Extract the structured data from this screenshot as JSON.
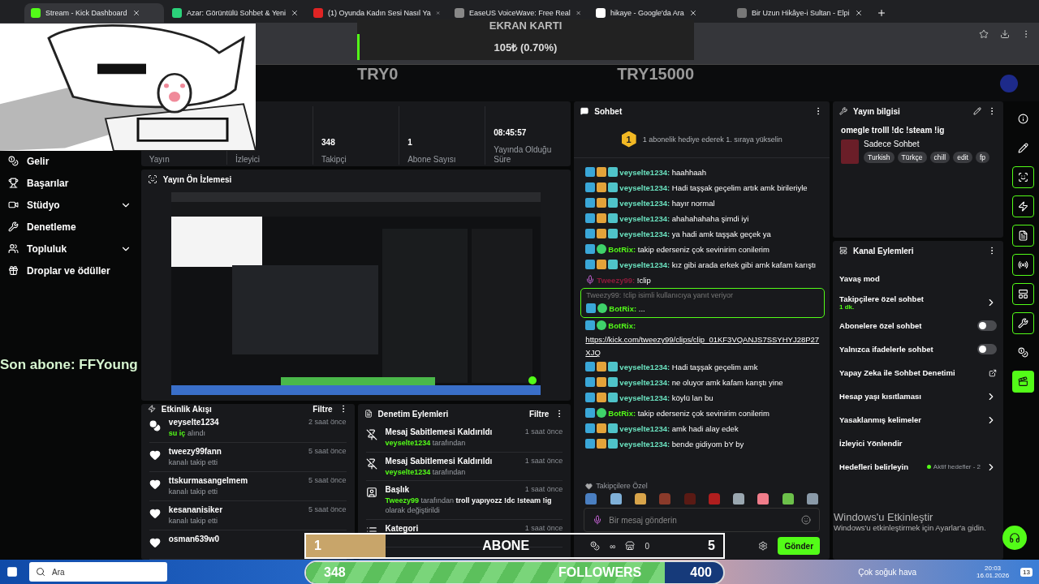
{
  "browser": {
    "tabs": [
      {
        "label": "Stream - Kick Dashboard",
        "selected": true
      },
      {
        "label": "Azar: Görüntülü Sohbet & Yeni",
        "selected": false
      },
      {
        "label": "(1) Oyunda Kadın Sesi Nasıl Ya",
        "selected": false
      },
      {
        "label": "EaseUS VoiceWave: Free Real",
        "selected": false
      },
      {
        "label": "hikaye - Google'da Ara",
        "selected": false
      },
      {
        "label": "Bir Uzun Hikâye-i Sultan - Elpi",
        "selected": false
      }
    ]
  },
  "goal_overlay": {
    "title": "EKRAN KARTI",
    "amount": "105₺ (0.70%)",
    "level": 0.007,
    "min": "TRY0",
    "max": "TRY15000"
  },
  "sidebar": {
    "items": [
      {
        "label": "Gelir",
        "expandable": false
      },
      {
        "label": "Başarılar",
        "expandable": false
      },
      {
        "label": "Stüdyo",
        "expandable": true
      },
      {
        "label": "Denetleme",
        "expandable": false
      },
      {
        "label": "Topluluk",
        "expandable": true
      },
      {
        "label": "Droplar ve ödüller",
        "expandable": false
      }
    ]
  },
  "stats": [
    {
      "label": "Yayın"
    },
    {
      "label": "İzleyici"
    },
    {
      "value": "348",
      "label": "Takipçi"
    },
    {
      "value": "1",
      "label": "Abone Sayısı"
    },
    {
      "value": "08:45:57",
      "label": "Yayında Olduğu Süre"
    }
  ],
  "preview": {
    "title": "Yayın Ön İzlemesi",
    "kind": "picture"
  },
  "last_sub_overlay": "Son abone: FFYoung",
  "activity": {
    "title": "Etkinlik Akışı",
    "filter": "Filtre",
    "items": [
      {
        "kind": "redeem",
        "user": "veyselte1234",
        "highlight": "su iç",
        "detail": "alındı",
        "time": "2 saat önce"
      },
      {
        "kind": "follow",
        "user": "tweezy99fann",
        "detail": "kanalı takip etti",
        "time": "5 saat önce"
      },
      {
        "kind": "follow",
        "user": "ttskurmasangelmem",
        "detail": "kanalı takip etti",
        "time": "5 saat önce"
      },
      {
        "kind": "follow",
        "user": "kesananisiker",
        "detail": "kanalı takip etti",
        "time": "5 saat önce"
      },
      {
        "kind": "follow",
        "user": "osman639w0"
      }
    ]
  },
  "mod_actions": {
    "title": "Denetim Eylemleri",
    "filter": "Filtre",
    "items": [
      {
        "kind": "unpin",
        "title": "Mesaj Sabitlemesi Kaldırıldı",
        "actor": "veyselte1234",
        "by": "tarafından",
        "time": "1 saat önce"
      },
      {
        "kind": "unpin",
        "title": "Mesaj Sabitlemesi Kaldırıldı",
        "actor": "veyselte1234",
        "by": "tarafından",
        "time": "1 saat önce"
      },
      {
        "kind": "title",
        "title": "Başlık",
        "actor": "Tweezy99",
        "by": "tarafından",
        "value": "troll yapıyozz !dc !steam !ig",
        "suffix": "olarak değiştirildi",
        "time": "1 saat önce"
      },
      {
        "kind": "category",
        "title": "Kategori",
        "time": "1 saat önce"
      }
    ]
  },
  "chat": {
    "title": "Sohbet",
    "gift_rank": "1",
    "gift_text": "1 abonelik hediye ederek 1. sıraya yükselin",
    "messages": [
      {
        "kind": "user",
        "name": "veyselte1234:",
        "text": "haahhaah"
      },
      {
        "kind": "user",
        "name": "veyselte1234:",
        "text": "Hadi taşşak geçelim artık amk birileriyle"
      },
      {
        "kind": "user",
        "name": "veyselte1234:",
        "text": "hayır normal"
      },
      {
        "kind": "user",
        "name": "veyselte1234:",
        "text": "ahahahahaha şimdi iyi"
      },
      {
        "kind": "user",
        "name": "veyselte1234:",
        "text": "ya hadi amk taşşak geçek ya"
      },
      {
        "kind": "bot",
        "name": "BotRix:",
        "text": "takip ederseniz çok sevinirim conilerim"
      },
      {
        "kind": "user",
        "name": "veyselte1234:",
        "text": "kız gibi arada erkek gibi amk kafam karıştı"
      },
      {
        "kind": "streamer",
        "name": "Tweezy99:",
        "text": "!clip"
      },
      {
        "kind": "bot",
        "name": "BotRix:",
        "reply_to": "Tweezy99: !clip isimli kullanıcıya yanıt veriyor",
        "text": "..."
      },
      {
        "kind": "bot",
        "name": "BotRix:",
        "link": "https://kick.com/tweezy99/clips/clip_01KF3VQANJS7SSYHYJ28P27XJQ"
      },
      {
        "kind": "user",
        "name": "veyselte1234:",
        "text": "Hadi taşşak geçelim amk"
      },
      {
        "kind": "user",
        "name": "veyselte1234:",
        "text": "ne oluyor amk kafam karıştı yine"
      },
      {
        "kind": "user",
        "name": "veyselte1234:",
        "text": "köylü lan bu"
      },
      {
        "kind": "bot",
        "name": "BotRix:",
        "text": "takip ederseniz çok sevinirim conilerim"
      },
      {
        "kind": "user",
        "name": "veyselte1234:",
        "text": "amk hadi alay edek"
      },
      {
        "kind": "user",
        "name": "veyselte1234:",
        "text": "bende gidiyom bY by"
      }
    ],
    "emote_title": "Takipçilere Özel",
    "emotes": [
      {
        "color": "#4a7fc1"
      },
      {
        "color": "#7fb0d8"
      },
      {
        "color": "#d8a44a"
      },
      {
        "color": "#8a3a2a"
      },
      {
        "color": "#5a1a14"
      },
      {
        "color": "#b01e1e"
      },
      {
        "color": "#9aa7b0"
      },
      {
        "color": "#f07c8a"
      },
      {
        "color": "#6cc04a"
      },
      {
        "color": "#8a9aa8"
      }
    ],
    "placeholder": "Bir mesaj gönderin",
    "points": "∞",
    "store_count": "0",
    "send": "Gönder"
  },
  "stream_info": {
    "title": "Yayın bilgisi",
    "stream_title": "omegle trolll !dc !steam !ig",
    "category": "Sadece Sohbet",
    "tags": [
      "Turkish",
      "Türkçe",
      "chill",
      "edit",
      "fp"
    ]
  },
  "channel_actions": {
    "title": "Kanal Eylemleri",
    "items": [
      {
        "kind": "plain",
        "label": "Yavaş mod"
      },
      {
        "kind": "nav",
        "label": "Takipçilere özel sohbet",
        "sub": "1 dk."
      },
      {
        "kind": "toggle",
        "label": "Abonelere özel sohbet",
        "on": false
      },
      {
        "kind": "toggle",
        "label": "Yalnızca ifadelerle sohbet",
        "on": false
      },
      {
        "kind": "external",
        "label": "Yapay Zeka ile Sohbet Denetimi"
      },
      {
        "kind": "nav",
        "label": "Hesap yaşı kısıtlaması"
      },
      {
        "kind": "nav",
        "label": "Yasaklanmış kelimeler"
      },
      {
        "kind": "plain",
        "label": "İzleyici Yönlendir"
      },
      {
        "kind": "nav",
        "label": "Hedefleri belirleyin",
        "status": "Aktif hedefler - 2"
      }
    ]
  },
  "tool_rail": [
    {
      "kind": "info",
      "selected": false
    },
    {
      "kind": "edit",
      "selected": false
    },
    {
      "kind": "camera",
      "selected": false
    },
    {
      "kind": "zap",
      "selected": false
    },
    {
      "kind": "notes",
      "selected": false
    },
    {
      "kind": "radio",
      "selected": false
    },
    {
      "kind": "layout",
      "selected": false
    },
    {
      "kind": "wrench",
      "selected": false
    },
    {
      "kind": "dots",
      "selected": false
    },
    {
      "kind": "clapper",
      "selected": true
    }
  ],
  "sub_goal": {
    "current": "1",
    "label": "ABONE",
    "target": "5",
    "level": 0.19
  },
  "follower_goal": {
    "current": "348",
    "label": "FOLLOWERS",
    "target": "400",
    "level": 0.86
  },
  "activation": {
    "title": "Windows'u Etkinleştir",
    "text": "Windows'u etkinleştirmek için Ayarlar'a gidin."
  },
  "taskbar": {
    "search": "Ara",
    "weather": "Çok soğuk hava",
    "time": "20:03",
    "date": "16.01.2026",
    "notifications": "13"
  }
}
